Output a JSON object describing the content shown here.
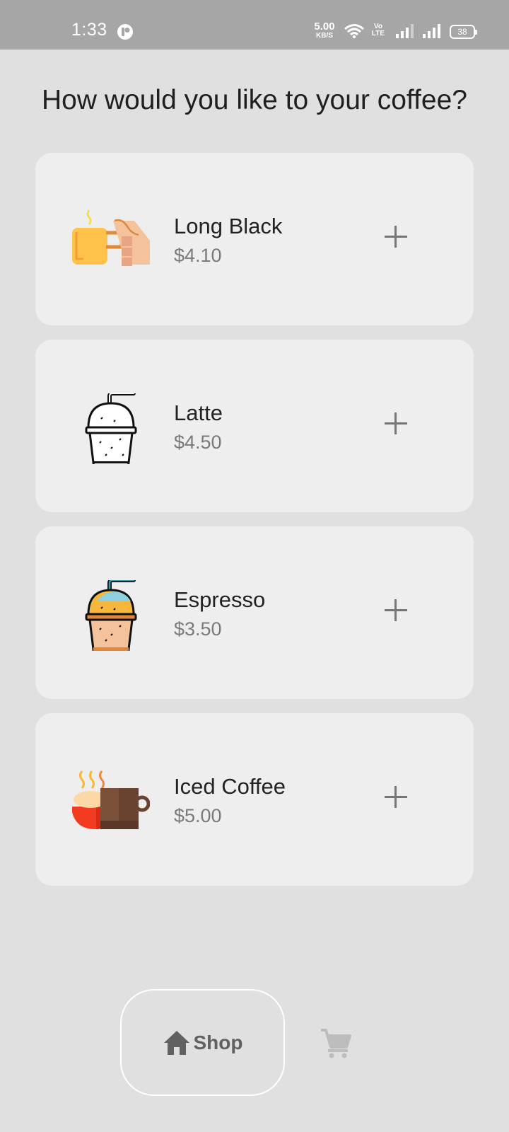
{
  "status_bar": {
    "time": "1:33",
    "net_speed_value": "5.00",
    "net_speed_unit": "KB/S",
    "volte_top": "Vo",
    "volte_bottom": "LTE",
    "battery": "38"
  },
  "page": {
    "title": "How would you like to your coffee?"
  },
  "products": [
    {
      "name": "Long Black",
      "price": "$4.10",
      "icon": "coffee-cup-hand-icon"
    },
    {
      "name": "Latte",
      "price": "$4.50",
      "icon": "takeaway-cup-outline-icon"
    },
    {
      "name": "Espresso",
      "price": "$3.50",
      "icon": "takeaway-cup-color-icon"
    },
    {
      "name": "Iced Coffee",
      "price": "$5.00",
      "icon": "hot-mug-steam-icon"
    }
  ],
  "bottom_nav": {
    "shop_label": "Shop",
    "active": "shop"
  },
  "colors": {
    "background": "#e0e0e0",
    "card": "#eeeeee",
    "status_bar": "#a6a6a6",
    "price": "#7a7a7a",
    "nav_active": "#616161",
    "nav_inactive": "#bdbdbd"
  }
}
